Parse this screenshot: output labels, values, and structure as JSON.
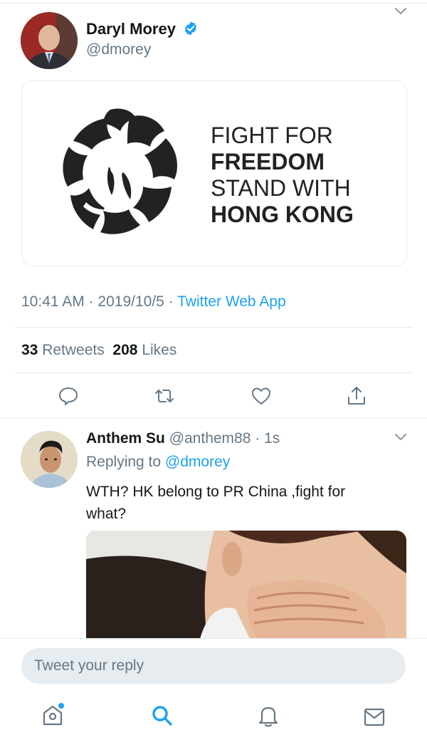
{
  "tweet": {
    "author_name": "Daryl Morey",
    "author_handle": "@dmorey",
    "card": {
      "line1": "FIGHT FOR",
      "line2": "FREEDOM",
      "line3": "STAND WITH",
      "line4": "HONG KONG"
    },
    "time": "10:41 AM",
    "sep1": " · ",
    "date": "2019/10/5",
    "sep2": " · ",
    "source": "Twitter Web App",
    "retweets_count": "33",
    "retweets_label": "Retweets",
    "likes_count": "208",
    "likes_label": "Likes",
    "actions": [
      "reply-icon",
      "retweet-icon",
      "like-icon",
      "share-icon"
    ]
  },
  "reply": {
    "name": "Anthem Su",
    "handle": "@anthem88",
    "dot": " · ",
    "age": "1s",
    "replying_prefix": "Replying to ",
    "replying_to": "@dmorey",
    "text": "WTH? HK belong to PR China ,fight for what?"
  },
  "composer": {
    "placeholder": "Tweet your reply"
  },
  "bottom_nav": [
    "home-icon",
    "search-icon",
    "notifications-icon",
    "messages-icon"
  ],
  "colors": {
    "accent": "#1da1f2",
    "text": "#14171a",
    "secondary": "#657786",
    "divider": "#e6ecf0"
  }
}
